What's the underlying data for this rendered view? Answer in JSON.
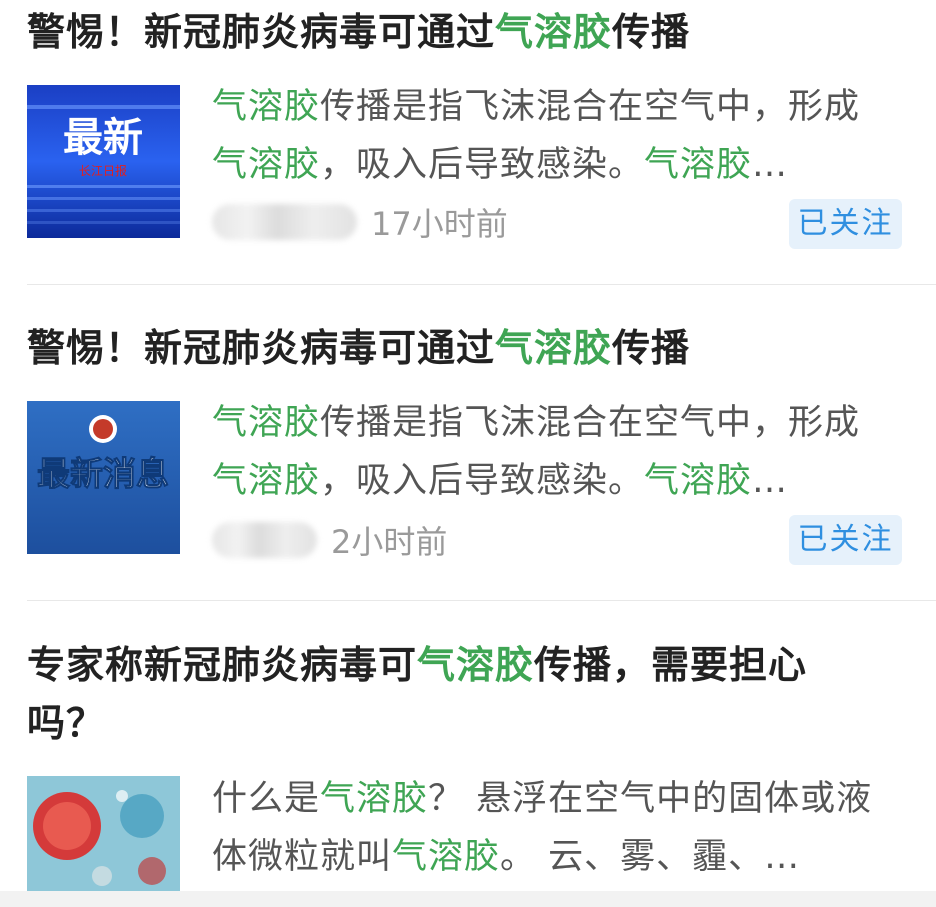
{
  "articles": [
    {
      "title": {
        "pre": "警惕！新冠肺炎病毒可通过",
        "hl": "气溶胶",
        "post": "传播"
      },
      "summary": {
        "hl1": "气溶胶",
        "t1": "传播是指飞沫混合在空气中，形成",
        "hl2": "气溶胶",
        "t2": "，吸入后导致感染。",
        "hl3": "气溶胶",
        "t3": "…"
      },
      "thumb_text": "最新",
      "thumb_sub": "长江日报",
      "time": "17小时前",
      "follow_label": "已关注"
    },
    {
      "title": {
        "pre": "警惕！新冠肺炎病毒可通过",
        "hl": "气溶胶",
        "post": "传播"
      },
      "summary": {
        "hl1": "气溶胶",
        "t1": "传播是指飞沫混合在空气中，形成",
        "hl2": "气溶胶",
        "t2": "，吸入后导致感染。",
        "hl3": "气溶胶",
        "t3": "…"
      },
      "thumb_text": "最新消息",
      "time": "2小时前",
      "follow_label": "已关注"
    },
    {
      "title": {
        "pre": "专家称新冠肺炎病毒可",
        "hl": "气溶胶",
        "post": "传播，需要担心吗？"
      },
      "summary": {
        "t0": "什么是",
        "hl1": "气溶胶",
        "t1": "？ 悬浮在空气中的固体或液体微粒就叫",
        "hl2": "气溶胶",
        "t2": "。 云、雾、霾、…"
      }
    }
  ],
  "colors": {
    "highlight": "#3fa554",
    "follow_bg": "#e6f1fb",
    "follow_text": "#2f8fe0"
  }
}
